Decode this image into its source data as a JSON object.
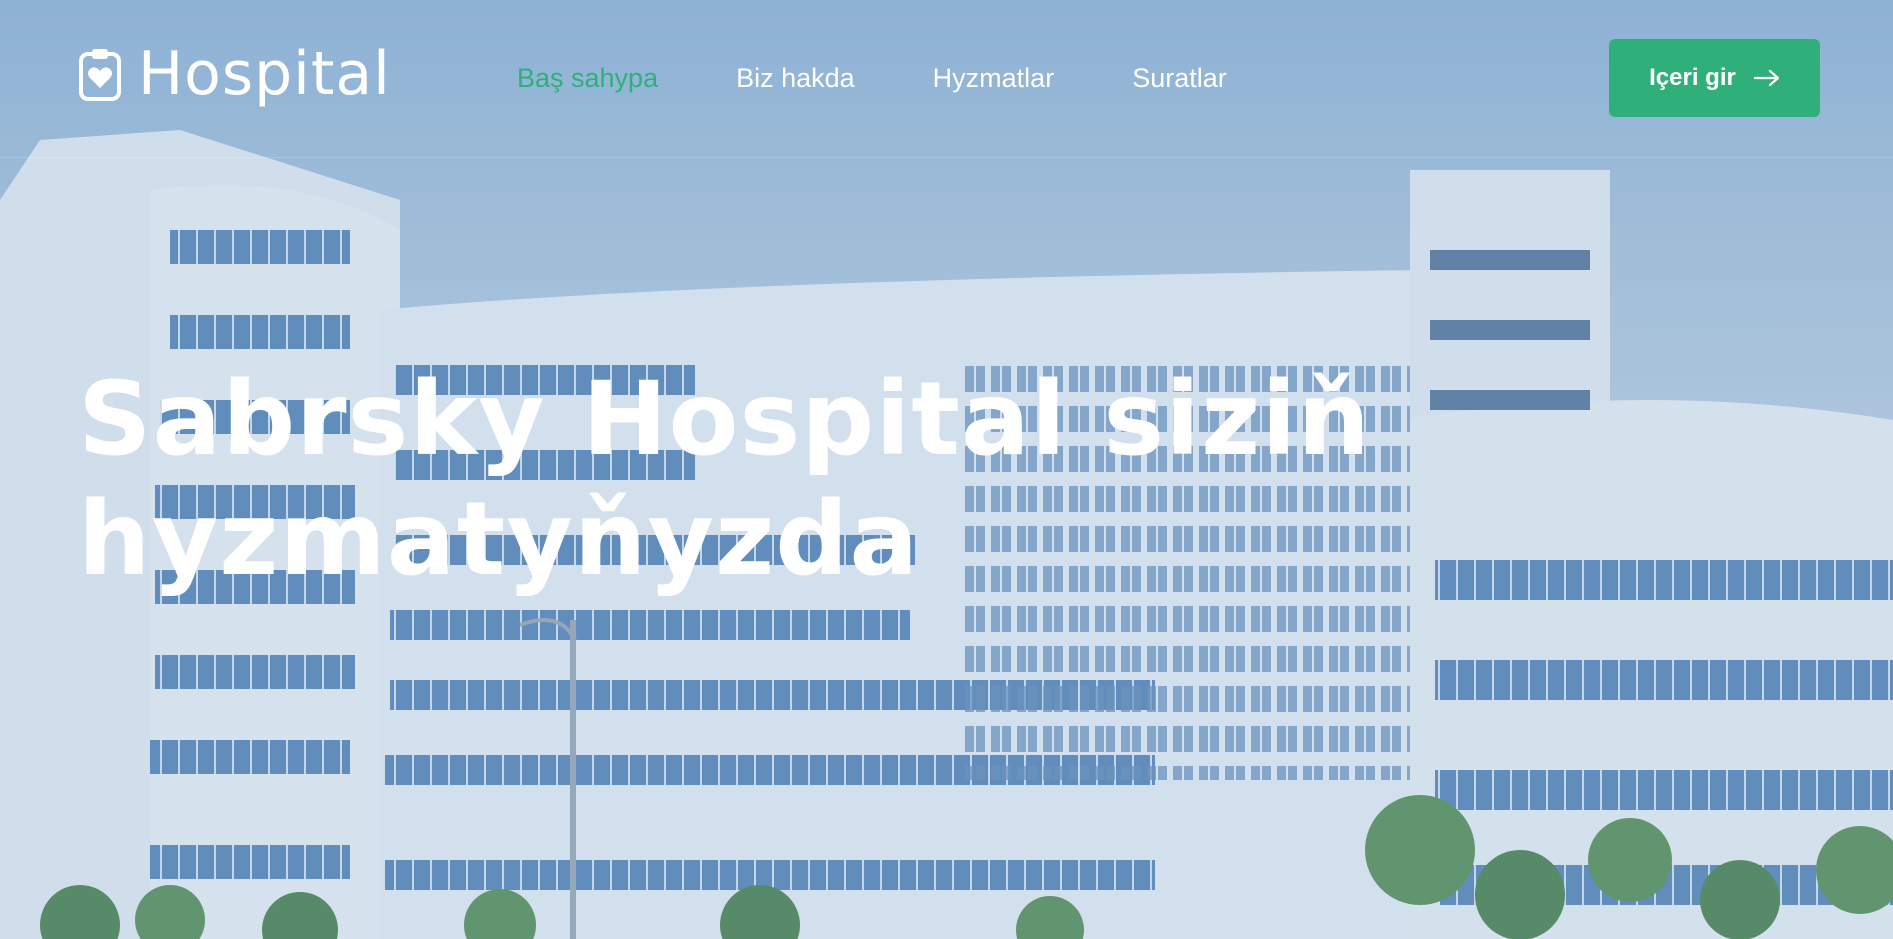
{
  "header": {
    "logo_text": "Hospital",
    "logo_icon": "clipboard-heart-icon",
    "nav": [
      {
        "label": "Baş sahypa",
        "active": true
      },
      {
        "label": "Biz hakda",
        "active": false
      },
      {
        "label": "Hyzmatlar",
        "active": false
      },
      {
        "label": "Suratlar",
        "active": false
      }
    ],
    "login_label": "Içeri gir",
    "login_icon": "arrow-right-icon"
  },
  "hero": {
    "title": "Sabrsky Hospital siziň hyzmatyňyzda"
  },
  "colors": {
    "accent": "#2fb07a",
    "text": "#ffffff"
  }
}
